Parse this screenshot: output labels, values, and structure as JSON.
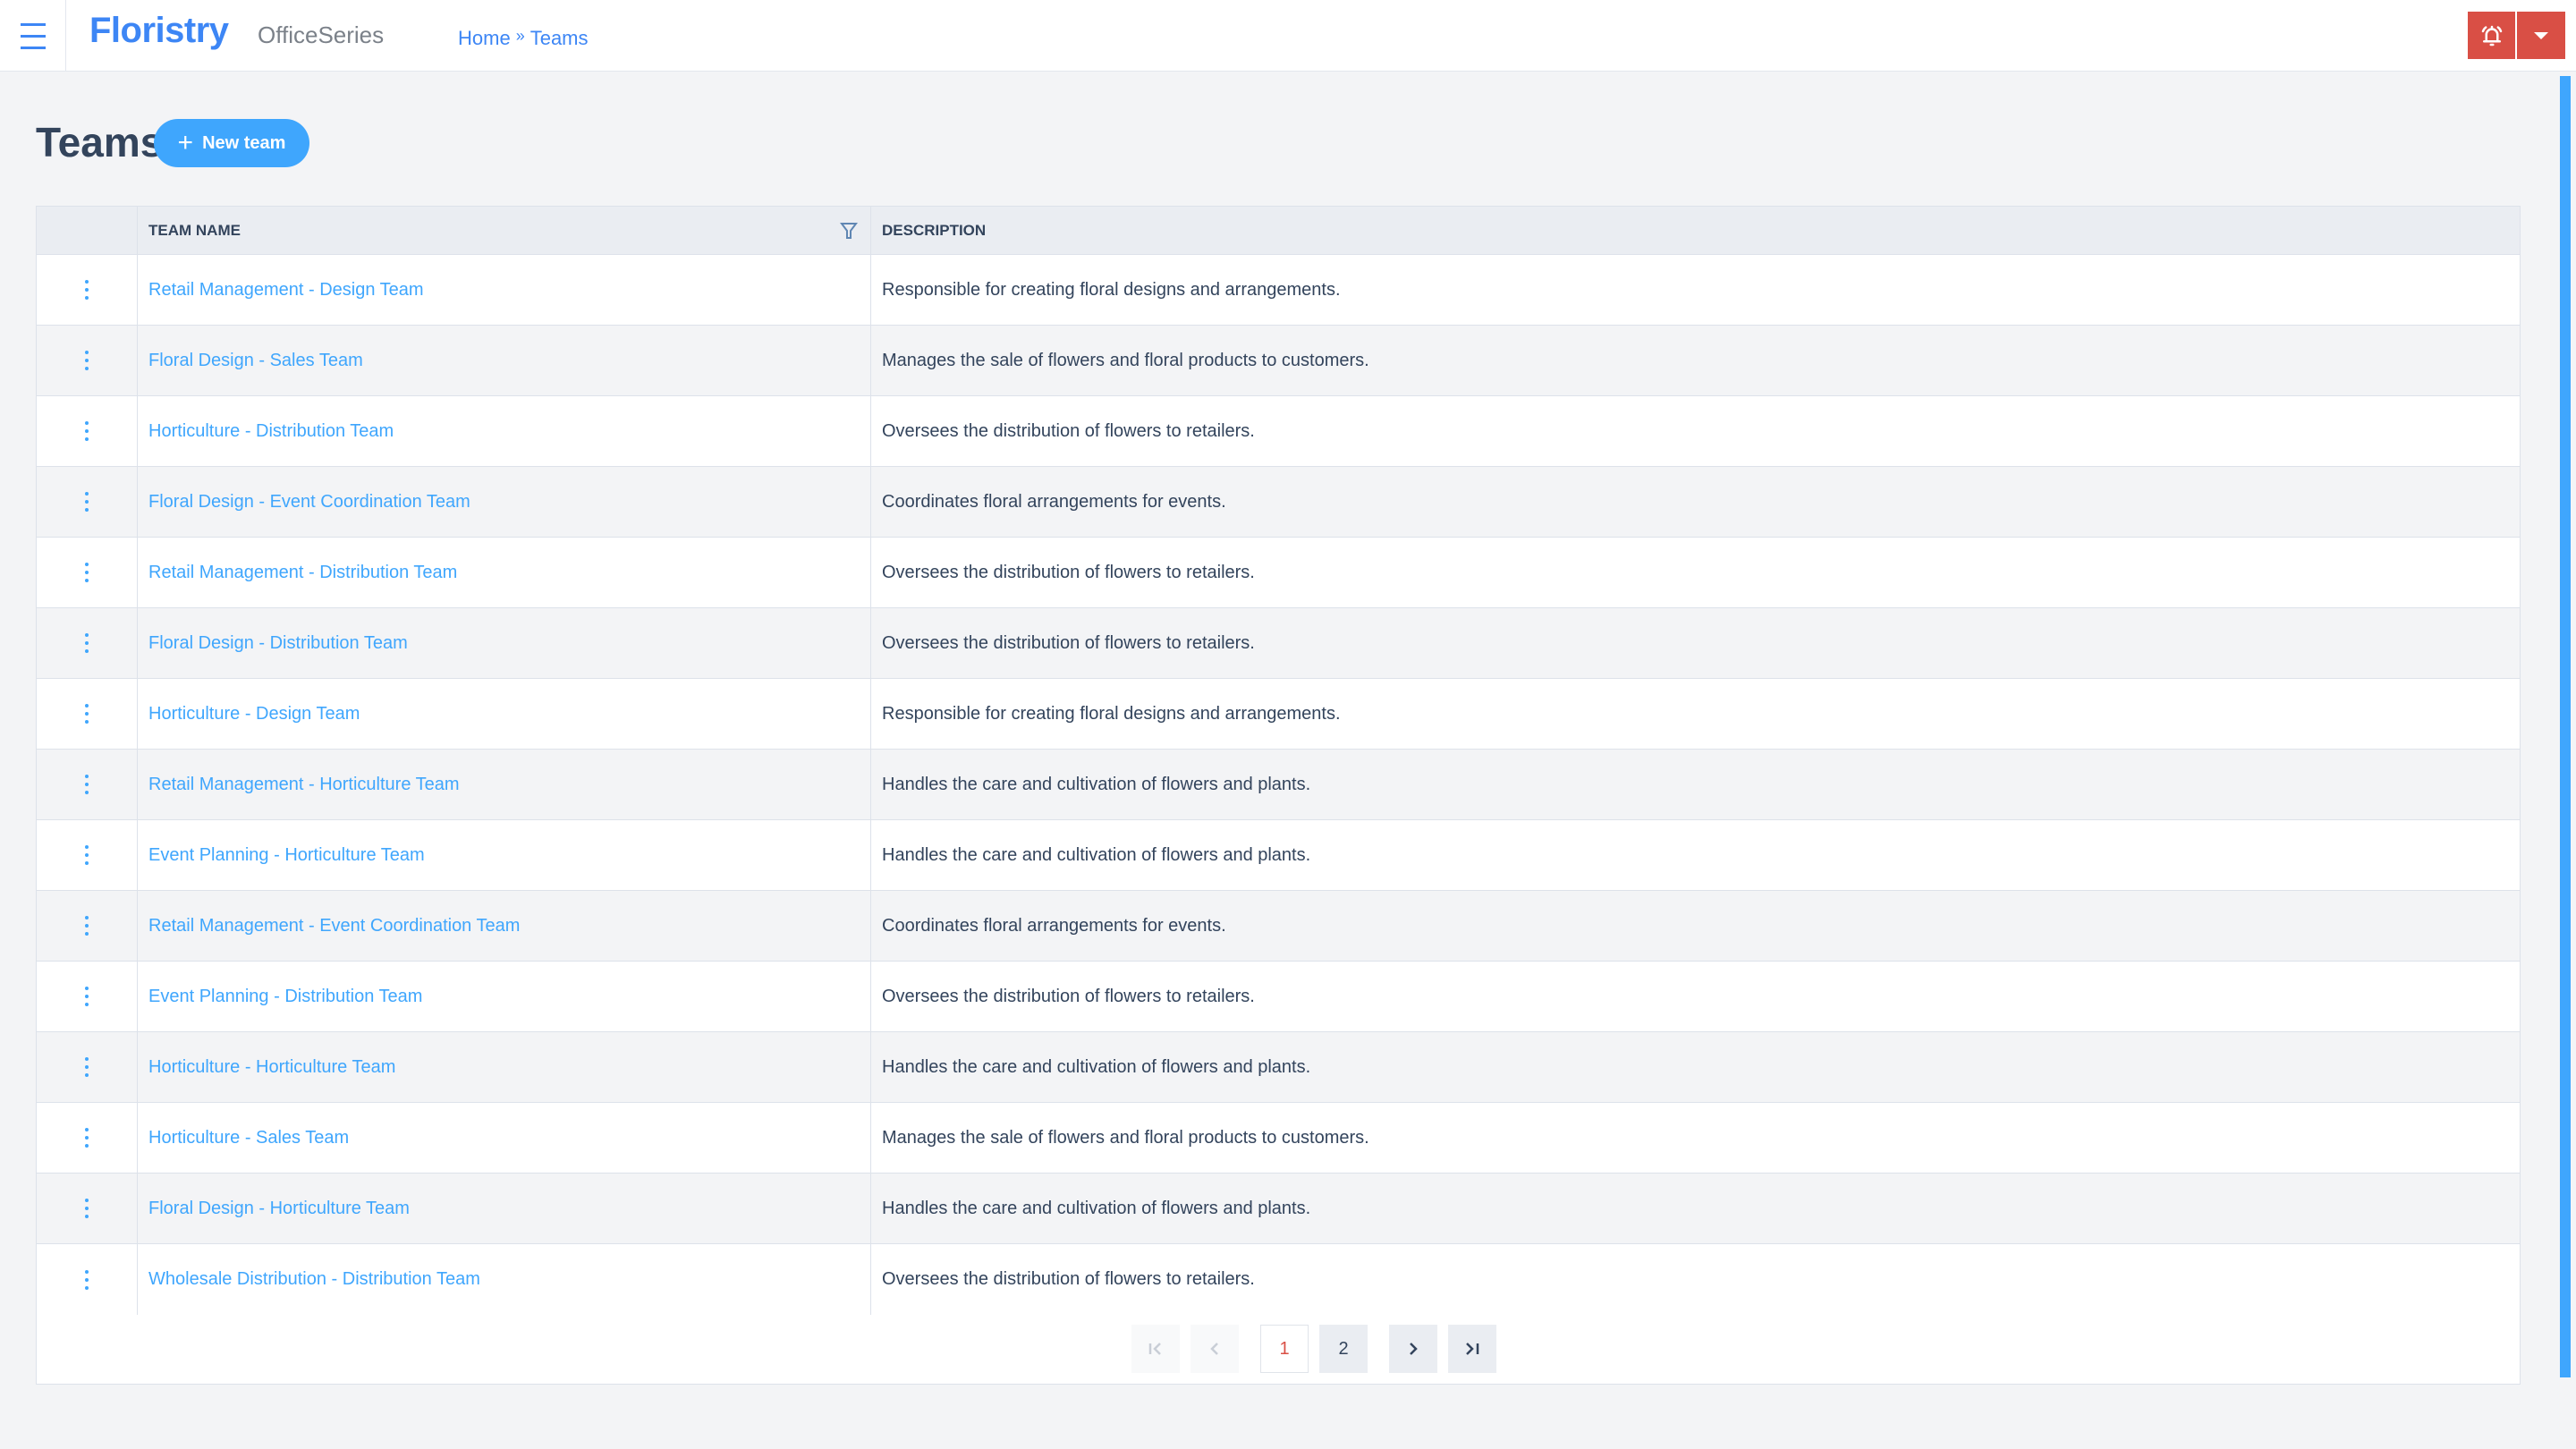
{
  "app": {
    "brand": "Floristry",
    "suite": "OfficeSeries"
  },
  "breadcrumb": {
    "home": "Home",
    "separator": "»",
    "current": "Teams"
  },
  "header_actions": {
    "alert_icon": "bell-ringing-icon",
    "dropdown_icon": "caret-down-icon",
    "color": "#d94f45"
  },
  "page": {
    "title": "Teams",
    "new_button_label": "New team"
  },
  "table": {
    "columns": [
      "",
      "TEAM NAME",
      "DESCRIPTION"
    ],
    "rows": [
      {
        "name": "Retail Management - Design Team",
        "description": "Responsible for creating floral designs and arrangements."
      },
      {
        "name": "Floral Design - Sales Team",
        "description": "Manages the sale of flowers and floral products to customers."
      },
      {
        "name": "Horticulture - Distribution Team",
        "description": "Oversees the distribution of flowers to retailers."
      },
      {
        "name": "Floral Design - Event Coordination Team",
        "description": "Coordinates floral arrangements for events."
      },
      {
        "name": "Retail Management - Distribution Team",
        "description": "Oversees the distribution of flowers to retailers."
      },
      {
        "name": "Floral Design - Distribution Team",
        "description": "Oversees the distribution of flowers to retailers."
      },
      {
        "name": "Horticulture - Design Team",
        "description": "Responsible for creating floral designs and arrangements."
      },
      {
        "name": "Retail Management - Horticulture Team",
        "description": "Handles the care and cultivation of flowers and plants."
      },
      {
        "name": "Event Planning - Horticulture Team",
        "description": "Handles the care and cultivation of flowers and plants."
      },
      {
        "name": "Retail Management - Event Coordination Team",
        "description": "Coordinates floral arrangements for events."
      },
      {
        "name": "Event Planning - Distribution Team",
        "description": "Oversees the distribution of flowers to retailers."
      },
      {
        "name": "Horticulture - Horticulture Team",
        "description": "Handles the care and cultivation of flowers and plants."
      },
      {
        "name": "Horticulture - Sales Team",
        "description": "Manages the sale of flowers and floral products to customers."
      },
      {
        "name": "Floral Design - Horticulture Team",
        "description": "Handles the care and cultivation of flowers and plants."
      },
      {
        "name": "Wholesale Distribution - Distribution Team",
        "description": "Oversees the distribution of flowers to retailers."
      }
    ]
  },
  "pagination": {
    "first": "|<",
    "prev": "<",
    "pages": [
      "1",
      "2"
    ],
    "current": "1",
    "next": ">",
    "last": ">|"
  }
}
